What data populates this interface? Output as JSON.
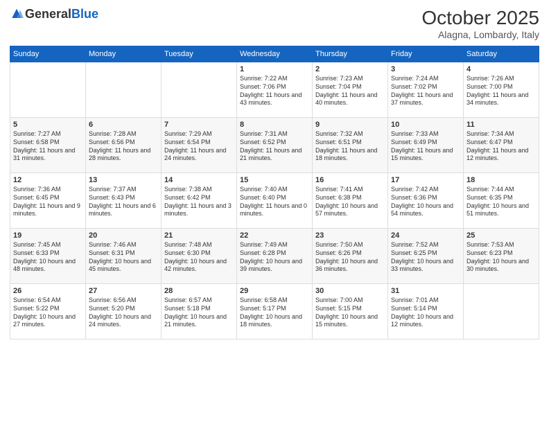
{
  "logo": {
    "general": "General",
    "blue": "Blue"
  },
  "header": {
    "title": "October 2025",
    "location": "Alagna, Lombardy, Italy"
  },
  "weekdays": [
    "Sunday",
    "Monday",
    "Tuesday",
    "Wednesday",
    "Thursday",
    "Friday",
    "Saturday"
  ],
  "weeks": [
    [
      {
        "day": "",
        "info": ""
      },
      {
        "day": "",
        "info": ""
      },
      {
        "day": "",
        "info": ""
      },
      {
        "day": "1",
        "info": "Sunrise: 7:22 AM\nSunset: 7:06 PM\nDaylight: 11 hours and 43 minutes."
      },
      {
        "day": "2",
        "info": "Sunrise: 7:23 AM\nSunset: 7:04 PM\nDaylight: 11 hours and 40 minutes."
      },
      {
        "day": "3",
        "info": "Sunrise: 7:24 AM\nSunset: 7:02 PM\nDaylight: 11 hours and 37 minutes."
      },
      {
        "day": "4",
        "info": "Sunrise: 7:26 AM\nSunset: 7:00 PM\nDaylight: 11 hours and 34 minutes."
      }
    ],
    [
      {
        "day": "5",
        "info": "Sunrise: 7:27 AM\nSunset: 6:58 PM\nDaylight: 11 hours and 31 minutes."
      },
      {
        "day": "6",
        "info": "Sunrise: 7:28 AM\nSunset: 6:56 PM\nDaylight: 11 hours and 28 minutes."
      },
      {
        "day": "7",
        "info": "Sunrise: 7:29 AM\nSunset: 6:54 PM\nDaylight: 11 hours and 24 minutes."
      },
      {
        "day": "8",
        "info": "Sunrise: 7:31 AM\nSunset: 6:52 PM\nDaylight: 11 hours and 21 minutes."
      },
      {
        "day": "9",
        "info": "Sunrise: 7:32 AM\nSunset: 6:51 PM\nDaylight: 11 hours and 18 minutes."
      },
      {
        "day": "10",
        "info": "Sunrise: 7:33 AM\nSunset: 6:49 PM\nDaylight: 11 hours and 15 minutes."
      },
      {
        "day": "11",
        "info": "Sunrise: 7:34 AM\nSunset: 6:47 PM\nDaylight: 11 hours and 12 minutes."
      }
    ],
    [
      {
        "day": "12",
        "info": "Sunrise: 7:36 AM\nSunset: 6:45 PM\nDaylight: 11 hours and 9 minutes."
      },
      {
        "day": "13",
        "info": "Sunrise: 7:37 AM\nSunset: 6:43 PM\nDaylight: 11 hours and 6 minutes."
      },
      {
        "day": "14",
        "info": "Sunrise: 7:38 AM\nSunset: 6:42 PM\nDaylight: 11 hours and 3 minutes."
      },
      {
        "day": "15",
        "info": "Sunrise: 7:40 AM\nSunset: 6:40 PM\nDaylight: 11 hours and 0 minutes."
      },
      {
        "day": "16",
        "info": "Sunrise: 7:41 AM\nSunset: 6:38 PM\nDaylight: 10 hours and 57 minutes."
      },
      {
        "day": "17",
        "info": "Sunrise: 7:42 AM\nSunset: 6:36 PM\nDaylight: 10 hours and 54 minutes."
      },
      {
        "day": "18",
        "info": "Sunrise: 7:44 AM\nSunset: 6:35 PM\nDaylight: 10 hours and 51 minutes."
      }
    ],
    [
      {
        "day": "19",
        "info": "Sunrise: 7:45 AM\nSunset: 6:33 PM\nDaylight: 10 hours and 48 minutes."
      },
      {
        "day": "20",
        "info": "Sunrise: 7:46 AM\nSunset: 6:31 PM\nDaylight: 10 hours and 45 minutes."
      },
      {
        "day": "21",
        "info": "Sunrise: 7:48 AM\nSunset: 6:30 PM\nDaylight: 10 hours and 42 minutes."
      },
      {
        "day": "22",
        "info": "Sunrise: 7:49 AM\nSunset: 6:28 PM\nDaylight: 10 hours and 39 minutes."
      },
      {
        "day": "23",
        "info": "Sunrise: 7:50 AM\nSunset: 6:26 PM\nDaylight: 10 hours and 36 minutes."
      },
      {
        "day": "24",
        "info": "Sunrise: 7:52 AM\nSunset: 6:25 PM\nDaylight: 10 hours and 33 minutes."
      },
      {
        "day": "25",
        "info": "Sunrise: 7:53 AM\nSunset: 6:23 PM\nDaylight: 10 hours and 30 minutes."
      }
    ],
    [
      {
        "day": "26",
        "info": "Sunrise: 6:54 AM\nSunset: 5:22 PM\nDaylight: 10 hours and 27 minutes."
      },
      {
        "day": "27",
        "info": "Sunrise: 6:56 AM\nSunset: 5:20 PM\nDaylight: 10 hours and 24 minutes."
      },
      {
        "day": "28",
        "info": "Sunrise: 6:57 AM\nSunset: 5:18 PM\nDaylight: 10 hours and 21 minutes."
      },
      {
        "day": "29",
        "info": "Sunrise: 6:58 AM\nSunset: 5:17 PM\nDaylight: 10 hours and 18 minutes."
      },
      {
        "day": "30",
        "info": "Sunrise: 7:00 AM\nSunset: 5:15 PM\nDaylight: 10 hours and 15 minutes."
      },
      {
        "day": "31",
        "info": "Sunrise: 7:01 AM\nSunset: 5:14 PM\nDaylight: 10 hours and 12 minutes."
      },
      {
        "day": "",
        "info": ""
      }
    ]
  ]
}
